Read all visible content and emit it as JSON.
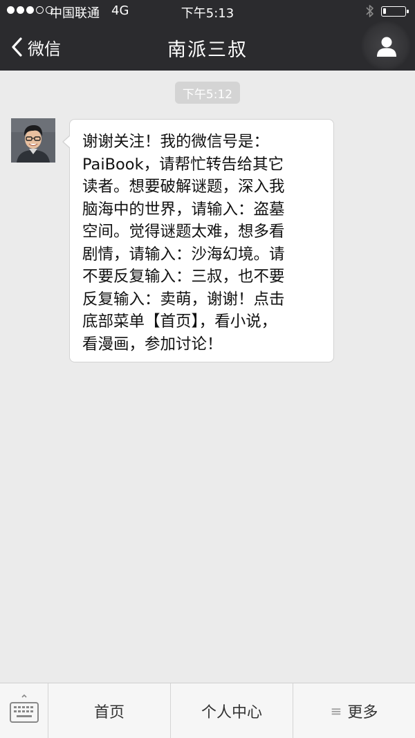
{
  "status_bar": {
    "carrier": "中国联通",
    "network": "4G",
    "time": "下午5:13",
    "battery_level": 0.15,
    "signal_bars": 3,
    "signal_total": 5
  },
  "nav": {
    "back_label": "微信",
    "title": "南派三叔",
    "back_icon": "chevron-left-icon",
    "profile_icon": "person-icon"
  },
  "chat": {
    "timestamp": "下午5:12",
    "message": {
      "lines": [
        "谢谢关注！我的微信号是：",
        "PaiBook，请帮忙转告给其它",
        "读者。想要破解谜题，深入我",
        "脑海中的世界，请输入：盗墓",
        "空间。觉得谜题太难，想多看",
        "剧情，请输入：沙海幻境。请",
        "不要反复输入：三叔，也不要",
        "反复输入：卖萌，谢谢！点击",
        "底部菜单【首页】，看小说，",
        "看漫画，参加讨论！"
      ]
    }
  },
  "bottom_menu": {
    "keyboard_icon": "keyboard-icon",
    "items": [
      "首页",
      "个人中心",
      "更多"
    ],
    "more_icon": "≡"
  },
  "colors": {
    "topbar": "#2b2b2e",
    "background": "#ebebeb",
    "bubble": "#ffffff",
    "timestamp_bg": "#d4d4d4"
  }
}
